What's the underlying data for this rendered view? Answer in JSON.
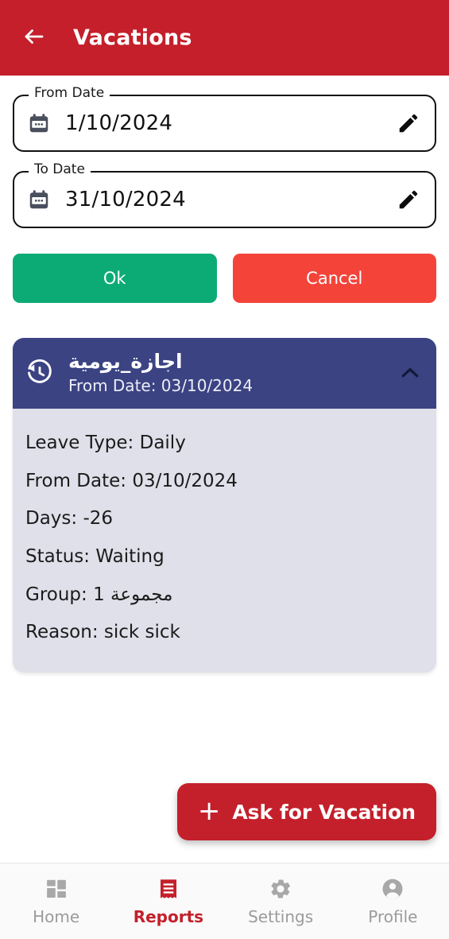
{
  "appbar": {
    "title": "Vacations",
    "back_icon": "arrow-left-icon",
    "bg_color": "#c41f2b"
  },
  "filters": {
    "from_field": {
      "label": "From Date",
      "value": "1/10/2024",
      "placeholder": "dd/mm/yyyy",
      "leading_icon": "calendar-icon",
      "trailing_icon": "pencil-edit-icon"
    },
    "to_field": {
      "label": "To Date",
      "value": "31/10/2024",
      "placeholder": "dd/mm/yyyy",
      "leading_icon": "calendar-icon",
      "trailing_icon": "pencil-edit-icon"
    },
    "ok_label": "Ok",
    "cancel_label": "Cancel",
    "ok_color": "#0cab76",
    "cancel_color": "#f4443a"
  },
  "vacation_card": {
    "header": {
      "icon": "history-icon",
      "title": "اجازة_يومية",
      "subtitle": "From Date: 03/10/2024",
      "expand_icon": "chevron-up-icon",
      "bg_color": "#3b4383"
    },
    "body_bg_color": "#e0e0ea",
    "details": [
      "Leave Type: Daily",
      "From Date: 03/10/2024",
      "Days: -26",
      "Status: Waiting",
      "Group: مجموعة 1",
      "Reason: sick sick"
    ]
  },
  "fab": {
    "label": "Ask for Vacation",
    "plus": "+",
    "icon": "plus-icon",
    "bg_color": "#c4202b"
  },
  "bottom_nav": {
    "active_color": "#c4202b",
    "inactive_color": "#9b9b9b",
    "items": [
      {
        "label": "Home",
        "icon": "dashboard-grid-icon",
        "active": false
      },
      {
        "label": "Reports",
        "icon": "receipt-list-icon",
        "active": true
      },
      {
        "label": "Settings",
        "icon": "gear-icon",
        "active": false
      },
      {
        "label": "Profile",
        "icon": "person-circle-icon",
        "active": false
      }
    ]
  }
}
